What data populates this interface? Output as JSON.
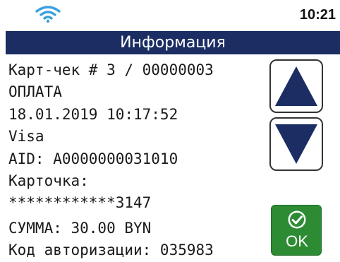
{
  "status": {
    "time": "10:21",
    "wifi_icon": "wifi-icon"
  },
  "header": {
    "title": "Информация"
  },
  "receipt": {
    "lines": [
      "Карт-чек # 3 / 00000003",
      "ОПЛАТА",
      "18.01.2019 10:17:52",
      "Visa",
      "AID: A0000000031010",
      "Карточка:",
      "************3147",
      "СУММА: 30.00 BYN",
      "Код авторизации: 035983"
    ]
  },
  "controls": {
    "up_icon": "arrow-up-icon",
    "down_icon": "arrow-down-icon",
    "ok_label": "OK",
    "ok_icon": "check-circle-icon"
  },
  "colors": {
    "header_bg": "#1b2d62",
    "arrow_fill": "#1b2d62",
    "ok_bg": "#2c8b33",
    "wifi": "#3aa0e0"
  }
}
